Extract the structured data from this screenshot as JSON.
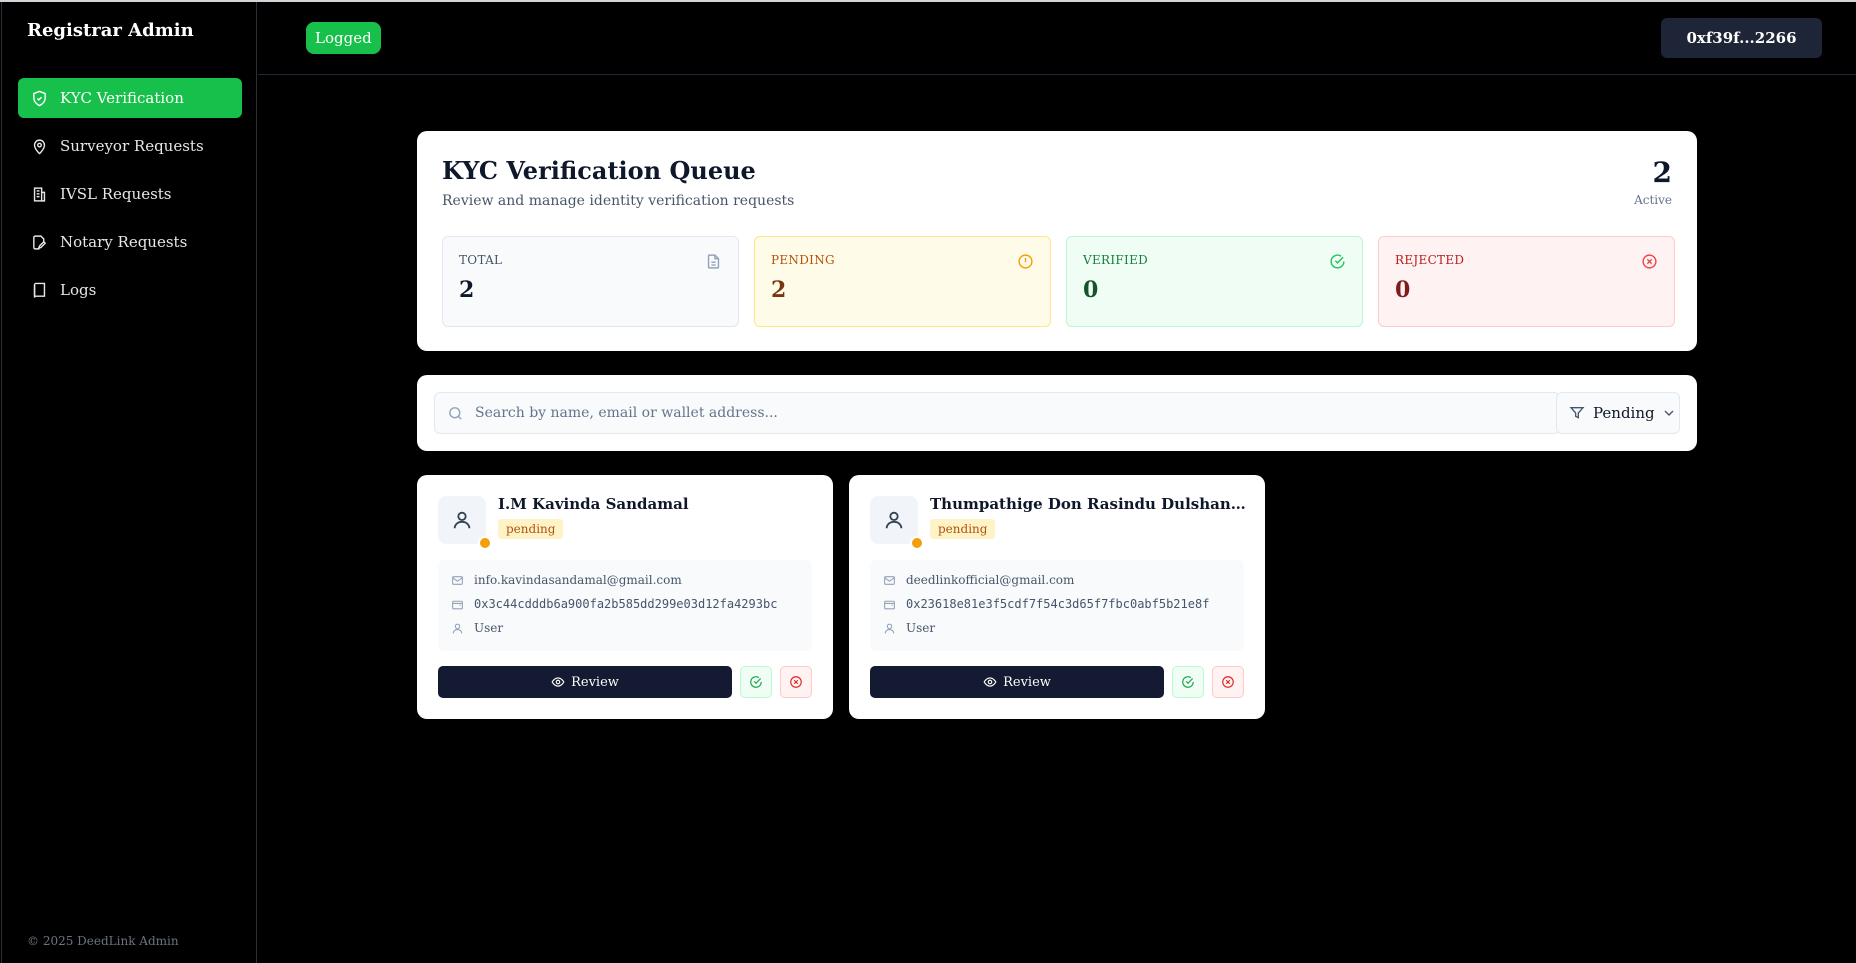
{
  "sidebar": {
    "brand": "Registrar Admin",
    "items": [
      {
        "label": "KYC Verification",
        "icon": "shield-check-icon",
        "active": true
      },
      {
        "label": "Surveyor Requests",
        "icon": "map-pin-icon"
      },
      {
        "label": "IVSL Requests",
        "icon": "building-icon"
      },
      {
        "label": "Notary Requests",
        "icon": "file-pen-icon"
      },
      {
        "label": "Logs",
        "icon": "book-icon"
      }
    ],
    "footer": "© 2025 DeedLink Admin"
  },
  "header": {
    "status": "Logged",
    "wallet": "0xf39f...2266"
  },
  "queue": {
    "title": "KYC Verification Queue",
    "subtitle": "Review and manage identity verification requests",
    "active_count": "2",
    "active_label": "Active",
    "stats": {
      "total": {
        "label": "TOTAL",
        "value": "2"
      },
      "pending": {
        "label": "PENDING",
        "value": "2"
      },
      "verified": {
        "label": "VERIFIED",
        "value": "0"
      },
      "rejected": {
        "label": "REJECTED",
        "value": "0"
      }
    }
  },
  "search": {
    "placeholder": "Search by name, email or wallet address...",
    "value": "",
    "filter": "Pending"
  },
  "requests": [
    {
      "name": "I.M Kavinda Sandamal",
      "status": "pending",
      "email": "info.kavindasandamal@gmail.com",
      "wallet": "0x3c44cdddb6a900fa2b585dd299e03d12fa4293bc",
      "role": "User",
      "review_label": "Review"
    },
    {
      "name": "Thumpathige Don Rasindu Dulshan Siriwardha...",
      "status": "pending",
      "email": "deedlinkofficial@gmail.com",
      "wallet": "0x23618e81e3f5cdf7f54c3d65f7fbc0abf5b21e8f",
      "role": "User",
      "review_label": "Review"
    }
  ],
  "colors": {
    "accent": "#16c04a",
    "sidebar_bg": "#000000",
    "review_button": "#141a31",
    "pending": "#f59e0b"
  }
}
